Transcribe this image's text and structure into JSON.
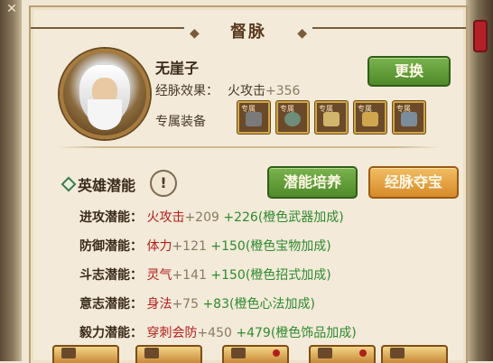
{
  "title": "督脉",
  "character": {
    "name": "无崖子",
    "effect_label": "经脉效果：",
    "effect_stat": "火攻击",
    "effect_value": "+356",
    "exclusive_label": "专属装备"
  },
  "buttons": {
    "change": "更换",
    "train": "潜能培养",
    "treasure": "经脉夺宝"
  },
  "potential": {
    "label": "英雄潜能",
    "info_symbol": "!",
    "rows": [
      {
        "key": "进攻潜能：",
        "stat": "火攻击",
        "base": "+209",
        "bonus": "+226",
        "bonus_desc": "(橙色武器加成)"
      },
      {
        "key": "防御潜能：",
        "stat": "体力",
        "base": "+121",
        "bonus": "+150",
        "bonus_desc": "(橙色宝物加成)"
      },
      {
        "key": "斗志潜能：",
        "stat": "灵气",
        "base": "+141",
        "bonus": "+150",
        "bonus_desc": "(橙色招式加成)"
      },
      {
        "key": "意志潜能：",
        "stat": "身法",
        "base": "+75",
        "bonus": "+83",
        "bonus_desc": "(橙色心法加成)"
      },
      {
        "key": "毅力潜能：",
        "stat": "穿刺会防",
        "base": "+450",
        "bonus": "+479",
        "bonus_desc": "(橙色饰品加成)"
      }
    ]
  },
  "equipment": [
    {
      "tag": "专属",
      "icon": "armor-icon"
    },
    {
      "tag": "专属",
      "icon": "bracer-icon"
    },
    {
      "tag": "专属",
      "icon": "scroll-icon"
    },
    {
      "tag": "专属",
      "icon": "book-icon"
    },
    {
      "tag": "专属",
      "icon": "treasure-icon"
    }
  ],
  "colors": {
    "accent_green": "#4f8a2a",
    "accent_orange": "#d68a29",
    "bonus_green": "#2f8a2f",
    "stat_red": "#b11f1b"
  }
}
